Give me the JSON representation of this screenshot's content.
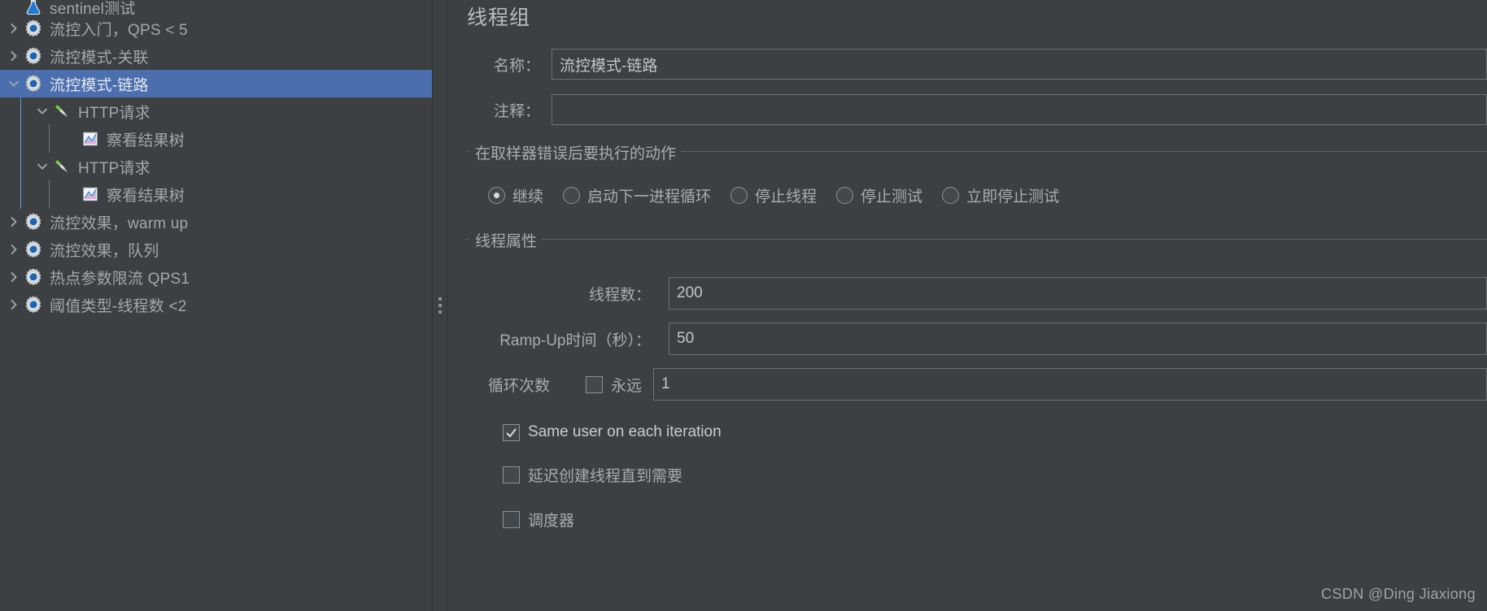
{
  "tree": {
    "nodes": [
      {
        "label": "sentinel测试",
        "icon": "test-plan-icon",
        "depth": 0,
        "twisty": "none",
        "state": "clipped",
        "selected": false
      },
      {
        "label": "流控入门，QPS < 5",
        "icon": "thread-group-icon",
        "depth": 0,
        "twisty": "collapsed",
        "state": "normal",
        "selected": false
      },
      {
        "label": "流控模式-关联",
        "icon": "thread-group-icon",
        "depth": 0,
        "twisty": "collapsed",
        "state": "normal",
        "selected": false
      },
      {
        "label": "流控模式-链路",
        "icon": "thread-group-icon",
        "depth": 0,
        "twisty": "expanded",
        "state": "normal",
        "selected": true
      },
      {
        "label": "HTTP请求",
        "icon": "http-sampler-icon",
        "depth": 1,
        "twisty": "expanded",
        "state": "normal",
        "selected": false
      },
      {
        "label": "察看结果树",
        "icon": "view-results-tree-icon",
        "depth": 2,
        "twisty": "none",
        "state": "normal",
        "selected": false
      },
      {
        "label": "HTTP请求",
        "icon": "http-sampler-icon",
        "depth": 1,
        "twisty": "expanded",
        "state": "normal",
        "selected": false
      },
      {
        "label": "察看结果树",
        "icon": "view-results-tree-icon",
        "depth": 2,
        "twisty": "none",
        "state": "normal",
        "selected": false
      },
      {
        "label": "流控效果，warm up",
        "icon": "thread-group-icon",
        "depth": 0,
        "twisty": "collapsed",
        "state": "normal",
        "selected": false
      },
      {
        "label": "流控效果，队列",
        "icon": "thread-group-icon",
        "depth": 0,
        "twisty": "collapsed",
        "state": "normal",
        "selected": false
      },
      {
        "label": "热点参数限流 QPS1",
        "icon": "thread-group-icon",
        "depth": 0,
        "twisty": "collapsed",
        "state": "normal",
        "selected": false
      },
      {
        "label": "阈值类型-线程数 <2",
        "icon": "thread-group-icon",
        "depth": 0,
        "twisty": "collapsed",
        "state": "normal",
        "selected": false
      }
    ]
  },
  "form": {
    "title": "线程组",
    "name_label": "名称：",
    "name_value": "流控模式-链路",
    "comment_label": "注释：",
    "comment_value": "",
    "error_action": {
      "title": "在取样器错误后要执行的动作",
      "options": [
        {
          "label": "继续",
          "checked": true
        },
        {
          "label": "启动下一进程循环",
          "checked": false
        },
        {
          "label": "停止线程",
          "checked": false
        },
        {
          "label": "停止测试",
          "checked": false
        },
        {
          "label": "立即停止测试",
          "checked": false
        }
      ]
    },
    "thread_props": {
      "title": "线程属性",
      "threads_label": "线程数：",
      "threads_value": "200",
      "rampup_label": "Ramp-Up时间（秒）：",
      "rampup_value": "50",
      "loop_label": "循环次数",
      "forever_label": "永远",
      "forever_checked": false,
      "loop_value": "1",
      "same_user_label": "Same user on each iteration",
      "same_user_checked": true,
      "delay_label": "延迟创建线程直到需要",
      "delay_checked": false,
      "scheduler_label": "调度器",
      "scheduler_checked": false
    }
  },
  "watermark": "CSDN @Ding Jiaxiong",
  "colors": {
    "background": "#3c4043",
    "selection": "#4b6eaf",
    "text": "#a9acae",
    "border": "#6b7074",
    "tree_guide_blue": "#6a9bd8"
  }
}
